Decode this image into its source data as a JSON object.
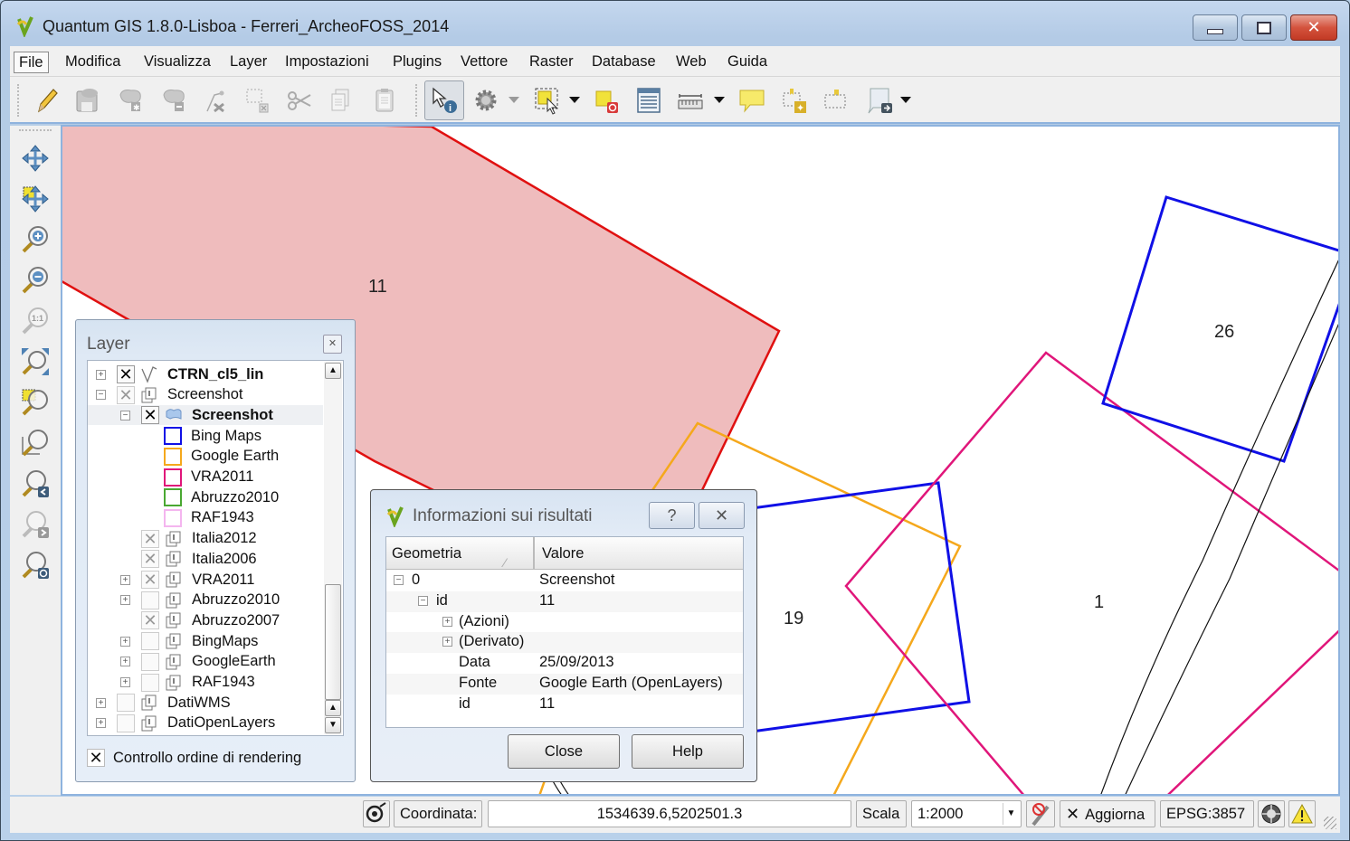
{
  "window": {
    "title": "Quantum GIS 1.8.0-Lisboa - Ferreri_ArcheoFOSS_2014",
    "controls": {
      "minimize": "minimize",
      "maximize": "maximize",
      "close": "✕"
    }
  },
  "menubar": {
    "items": [
      {
        "label": "File",
        "active": true
      },
      {
        "label": "Modifica"
      },
      {
        "label": "Visualizza"
      },
      {
        "label": "Layer"
      },
      {
        "label": "Impostazioni"
      },
      {
        "label": "Plugins"
      },
      {
        "label": "Vettore"
      },
      {
        "label": "Raster"
      },
      {
        "label": "Database"
      },
      {
        "label": "Web"
      },
      {
        "label": "Guida"
      }
    ]
  },
  "toolbar": {
    "buttons": [
      {
        "name": "toggle-editing-icon",
        "enabled": true
      },
      {
        "name": "save-edits-icon",
        "enabled": false
      },
      {
        "name": "add-feature-icon",
        "enabled": false
      },
      {
        "name": "move-feature-icon",
        "enabled": false
      },
      {
        "name": "node-tool-icon",
        "enabled": false
      },
      {
        "name": "delete-selected-icon",
        "enabled": false
      },
      {
        "name": "cut-features-icon",
        "enabled": false
      },
      {
        "name": "copy-features-icon",
        "enabled": false
      },
      {
        "name": "paste-features-icon",
        "enabled": false
      },
      {
        "name": "identify-features-icon",
        "enabled": true,
        "pressed": true
      },
      {
        "name": "run-action-icon",
        "enabled": false,
        "dropdown": true
      },
      {
        "name": "select-features-icon",
        "enabled": true,
        "dropdown": true
      },
      {
        "name": "deselect-all-icon",
        "enabled": true
      },
      {
        "name": "open-attribute-table-icon",
        "enabled": true
      },
      {
        "name": "measure-line-icon",
        "enabled": true,
        "dropdown": true
      },
      {
        "name": "map-tips-icon",
        "enabled": true
      },
      {
        "name": "new-bookmark-icon",
        "enabled": true
      },
      {
        "name": "show-bookmarks-icon",
        "enabled": true
      },
      {
        "name": "text-annotation-icon",
        "enabled": true,
        "dropdown": true
      }
    ]
  },
  "map_navigation": {
    "tools": [
      "pan-map-icon",
      "pan-to-selection-icon",
      "zoom-in-icon",
      "zoom-out-icon",
      "zoom-actual-size-icon",
      "zoom-full-icon",
      "zoom-to-selection-icon",
      "zoom-to-layer-icon",
      "zoom-last-icon",
      "zoom-next-icon",
      "refresh-icon"
    ]
  },
  "map": {
    "labels": [
      {
        "text": "11",
        "feature": "Screenshot polygon (selected)"
      },
      {
        "text": "26",
        "feature": "Bing Maps"
      },
      {
        "text": "19",
        "feature": "Bing Maps"
      },
      {
        "text": "1",
        "feature": "VRA2011"
      }
    ],
    "colors": {
      "selected_fill": "#efbcbd",
      "selected_stroke": "#e01010",
      "bing_maps": "#1010e6",
      "google_earth": "#f5a81c",
      "vra2011": "#e0167a",
      "abruzzo2010": "#4aa832",
      "raf1943": "#f4b5ef",
      "ctrn_lines": "#111111"
    }
  },
  "layer_panel": {
    "title": "Layer",
    "rows": [
      {
        "label": "CTRN_cl5_lin",
        "bold": true,
        "expander": "+",
        "check": "on",
        "icon": "line-layer-icon",
        "indent": 0
      },
      {
        "label": "Screenshot",
        "bold": false,
        "expander": "-",
        "check": "dim",
        "icon": "group-icon",
        "indent": 0
      },
      {
        "label": "Screenshot",
        "bold": true,
        "expander": "-",
        "check": "on",
        "icon": "polygon-layer-icon",
        "indent": 1,
        "selected": true
      },
      {
        "label": "Bing Maps",
        "legend_color": "#1010e6",
        "indent": 2
      },
      {
        "label": "Google Earth",
        "legend_color": "#f5a81c",
        "indent": 2
      },
      {
        "label": "VRA2011",
        "legend_color": "#e0167a",
        "indent": 2
      },
      {
        "label": "Abruzzo2010",
        "legend_color": "#4aa832",
        "indent": 2
      },
      {
        "label": "RAF1943",
        "legend_color": "#f4b5ef",
        "indent": 2
      },
      {
        "label": "Italia2012",
        "expander": "",
        "check": "dim",
        "icon": "group-icon",
        "indent": 1
      },
      {
        "label": "Italia2006",
        "expander": "",
        "check": "dim",
        "icon": "group-icon",
        "indent": 1
      },
      {
        "label": "VRA2011",
        "expander": "+",
        "check": "dim",
        "icon": "group-icon",
        "indent": 1
      },
      {
        "label": "Abruzzo2010",
        "expander": "+",
        "check": "off",
        "icon": "group-icon",
        "indent": 1
      },
      {
        "label": "Abruzzo2007",
        "expander": "",
        "check": "dim",
        "icon": "group-icon",
        "indent": 1
      },
      {
        "label": "BingMaps",
        "expander": "+",
        "check": "off",
        "icon": "group-icon",
        "indent": 1
      },
      {
        "label": "GoogleEarth",
        "expander": "+",
        "check": "off",
        "icon": "group-icon",
        "indent": 1
      },
      {
        "label": "RAF1943",
        "expander": "+",
        "check": "off",
        "icon": "group-icon",
        "indent": 1
      },
      {
        "label": "DatiWMS",
        "expander": "+",
        "check": "off",
        "icon": "group-icon",
        "indent": 0
      },
      {
        "label": "DatiOpenLayers",
        "expander": "+",
        "check": "off",
        "icon": "group-icon",
        "indent": 0
      }
    ],
    "render_order_label": "Controllo ordine di rendering",
    "render_order_checked": true
  },
  "info_dialog": {
    "title": "Informazioni sui risultati",
    "help_glyph": "?",
    "close_glyph": "✕",
    "columns": [
      "Geometria",
      "Valore"
    ],
    "rows": [
      {
        "key": "0",
        "value": "Screenshot",
        "expander": "-",
        "depth": 0
      },
      {
        "key": "id",
        "value": "11",
        "expander": "-",
        "depth": 1
      },
      {
        "key": "(Azioni)",
        "value": "",
        "expander": "+",
        "depth": 2
      },
      {
        "key": "(Derivato)",
        "value": "",
        "expander": "+",
        "depth": 2
      },
      {
        "key": "Data",
        "value": "25/09/2013",
        "expander": "",
        "depth": 2
      },
      {
        "key": "Fonte",
        "value": "Google Earth (OpenLayers)",
        "expander": "",
        "depth": 2
      },
      {
        "key": "id",
        "value": "11",
        "expander": "",
        "depth": 2
      }
    ],
    "close_label": "Close",
    "help_label": "Help"
  },
  "statusbar": {
    "coord_label": "Coordinata:",
    "coord_value": "1534639.6,5202501.3",
    "scale_label": "Scala",
    "scale_value": "1:2000",
    "render_label": "Aggiorna",
    "render_checked": true,
    "crs": "EPSG:3857"
  }
}
